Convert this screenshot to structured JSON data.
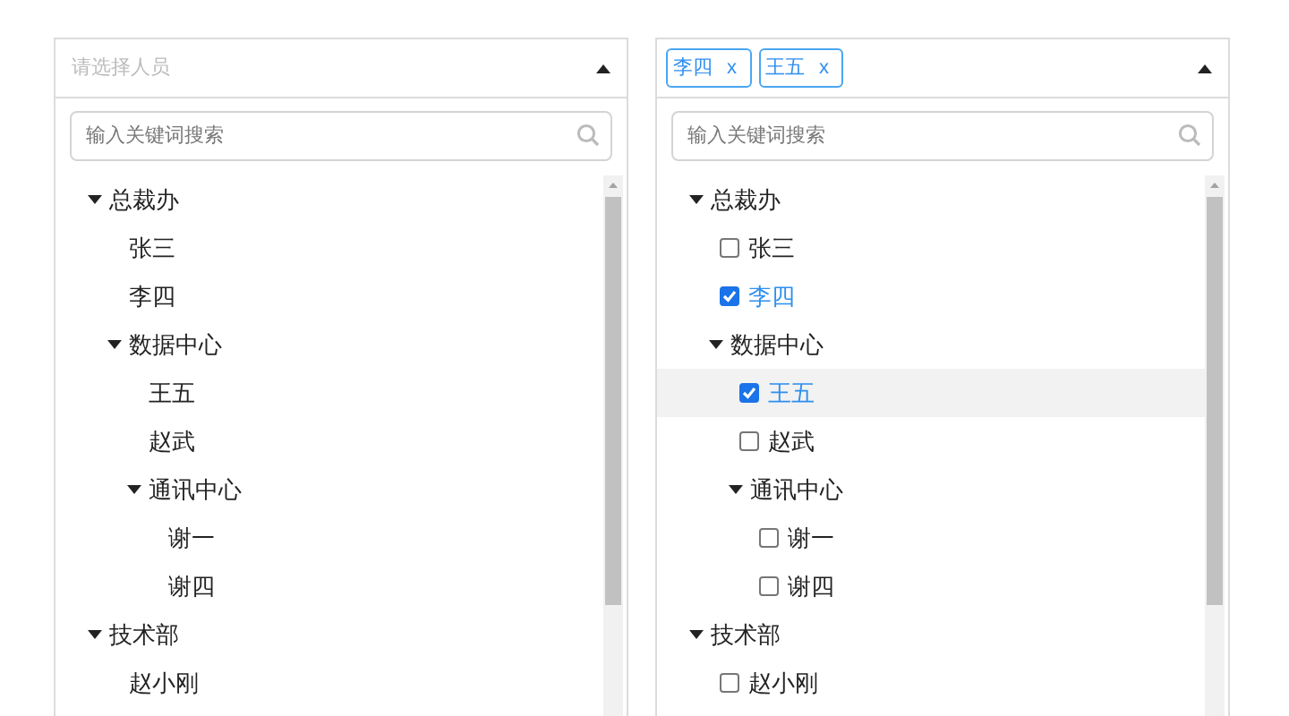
{
  "panels": [
    {
      "placeholder": "请选择人员",
      "search": {
        "placeholder": "输入关键词搜索"
      },
      "tree": [
        {
          "kind": "group",
          "label": "总裁办",
          "expanded": true,
          "children": [
            {
              "kind": "person",
              "label": "张三",
              "hovered": false
            },
            {
              "kind": "person",
              "label": "李四",
              "hovered": false
            },
            {
              "kind": "group",
              "label": "数据中心",
              "expanded": true,
              "children": [
                {
                  "kind": "person",
                  "label": "王五",
                  "hovered": false
                },
                {
                  "kind": "person",
                  "label": "赵武",
                  "hovered": false
                },
                {
                  "kind": "group",
                  "label": "通讯中心",
                  "expanded": true,
                  "children": [
                    {
                      "kind": "person",
                      "label": "谢一",
                      "hovered": false
                    },
                    {
                      "kind": "person",
                      "label": "谢四",
                      "hovered": false
                    }
                  ]
                }
              ]
            }
          ]
        },
        {
          "kind": "group",
          "label": "技术部",
          "expanded": true,
          "children": [
            {
              "kind": "person",
              "label": "赵小刚",
              "hovered": false
            }
          ]
        }
      ]
    },
    {
      "tags": [
        {
          "label": "李四",
          "remove": "x"
        },
        {
          "label": "王五",
          "remove": "x"
        }
      ],
      "search": {
        "placeholder": "输入关键词搜索"
      },
      "tree": [
        {
          "kind": "group",
          "label": "总裁办",
          "expanded": true,
          "children": [
            {
              "kind": "person",
              "label": "张三",
              "checked": false,
              "hovered": false
            },
            {
              "kind": "person",
              "label": "李四",
              "checked": true,
              "hovered": false
            },
            {
              "kind": "group",
              "label": "数据中心",
              "expanded": true,
              "children": [
                {
                  "kind": "person",
                  "label": "王五",
                  "checked": true,
                  "hovered": true
                },
                {
                  "kind": "person",
                  "label": "赵武",
                  "checked": false,
                  "hovered": false
                },
                {
                  "kind": "group",
                  "label": "通讯中心",
                  "expanded": true,
                  "children": [
                    {
                      "kind": "person",
                      "label": "谢一",
                      "checked": false,
                      "hovered": false
                    },
                    {
                      "kind": "person",
                      "label": "谢四",
                      "checked": false,
                      "hovered": false
                    }
                  ]
                }
              ]
            }
          ]
        },
        {
          "kind": "group",
          "label": "技术部",
          "expanded": true,
          "children": [
            {
              "kind": "person",
              "label": "赵小刚",
              "checked": false,
              "hovered": false
            }
          ]
        }
      ]
    }
  ]
}
